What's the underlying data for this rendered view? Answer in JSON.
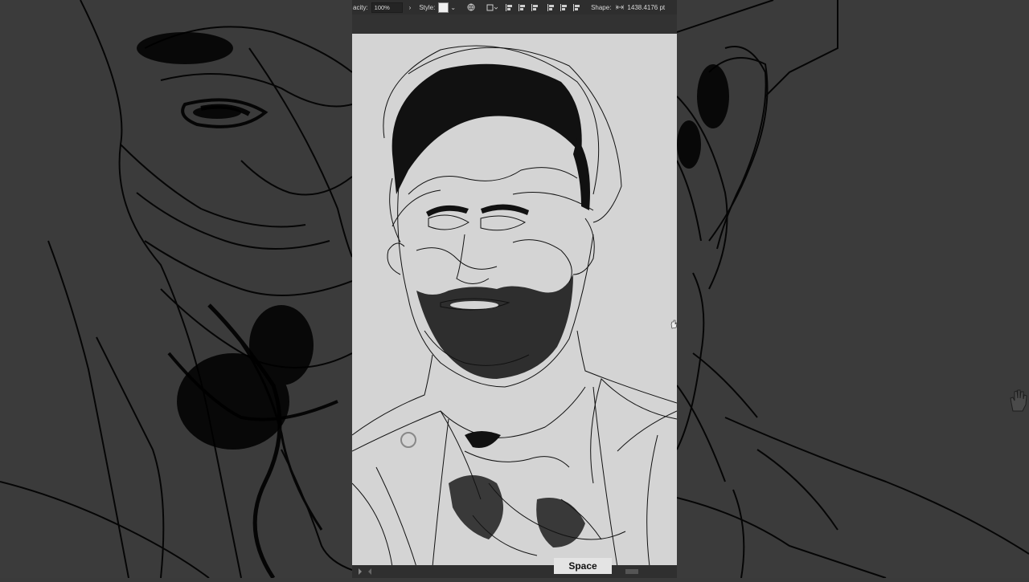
{
  "toolbar": {
    "opacity_label": "acity:",
    "opacity_value": "100%",
    "style_label": "Style:",
    "shape_label": "Shape:",
    "width_value": "1438.4176 pt"
  },
  "overlay": {
    "key_hint": "Space"
  },
  "icons": [
    "chevron-right-icon",
    "style-swatch",
    "chevron-down-icon",
    "globe-icon",
    "transform-icon",
    "align-left-icon",
    "align-center-icon",
    "align-right-icon",
    "align-top-icon",
    "align-middle-icon",
    "align-bottom-icon",
    "width-arrows-icon",
    "hand-cursor-icon"
  ],
  "colors": {
    "canvas_bg": "#d4d4d4",
    "chrome_bg": "#2e2e2e",
    "dimmed_bg": "#3b3b3b"
  }
}
